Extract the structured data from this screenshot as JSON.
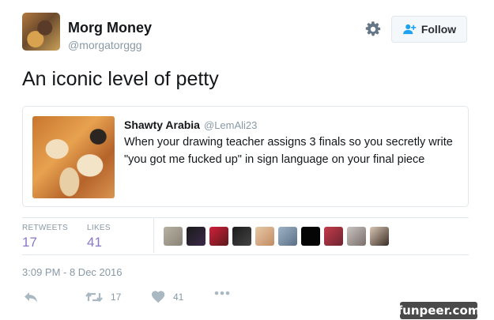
{
  "user": {
    "name": "Morg Money",
    "handle": "@morgatorggg"
  },
  "follow_button": {
    "label": "Follow"
  },
  "tweet": {
    "text": "An iconic level of petty"
  },
  "quoted_tweet": {
    "name": "Shawty Arabia",
    "handle": "@LemAli23",
    "line1": "When your drawing teacher assigns 3 finals so you secretly write",
    "line2": "\"you got me fucked up\" in sign language on your final piece"
  },
  "stats": {
    "retweets_label": "RETWEETS",
    "retweets_count": "17",
    "likes_label": "LIKES",
    "likes_count": "41"
  },
  "likers": [
    {
      "bg": "linear-gradient(135deg,#b7b1a3,#8a8377)"
    },
    {
      "bg": "linear-gradient(135deg,#1a1a1a,#3b2a4a)"
    },
    {
      "bg": "linear-gradient(135deg,#d21f3c,#5b1a1a)"
    },
    {
      "bg": "linear-gradient(135deg,#1b1b1b,#444)"
    },
    {
      "bg": "linear-gradient(135deg,#e7c9a5,#c28b63)"
    },
    {
      "bg": "linear-gradient(135deg,#9fb3c8,#5a6e85)"
    },
    {
      "bg": "#050505"
    },
    {
      "bg": "linear-gradient(135deg,#c43b4a,#6d2431)"
    },
    {
      "bg": "linear-gradient(135deg,#c9c3c0,#7a6e6a)"
    },
    {
      "bg": "linear-gradient(135deg,#d8c6b4,#3a2d26)"
    }
  ],
  "timestamp": "3:09 PM - 8 Dec 2016",
  "actions": {
    "retweet_count": "17",
    "like_count": "41"
  },
  "watermark": "funpeer.com",
  "colors": {
    "accent": "#1da1f2",
    "stat_value": "#8b76c8",
    "muted": "#8899a6"
  },
  "icons": [
    "gear-icon",
    "follow-person-plus-icon",
    "reply-icon",
    "retweet-icon",
    "heart-icon",
    "more-icon"
  ]
}
